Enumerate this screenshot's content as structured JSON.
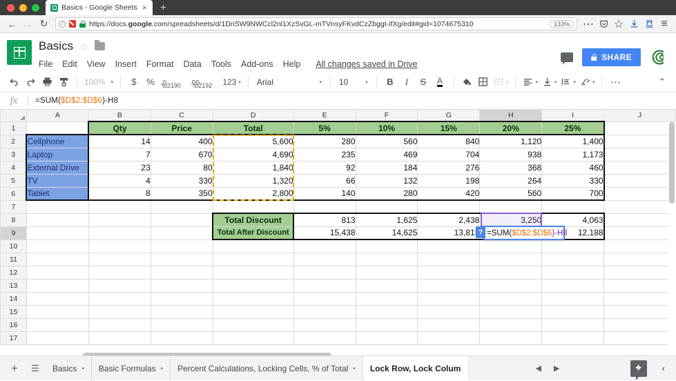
{
  "browser": {
    "tab": {
      "title": "Basics - Google Sheets",
      "favicon": "sheets-favicon",
      "close": "×"
    },
    "new_tab": "+",
    "back": "←",
    "forward": "→",
    "reload": "↻",
    "url": "https://docs.google.com/spreadsheets/d/1DnSW9NWCcl2nl1XzSvGL-mTVnsyFKvdCzZbggt-ifXg/edit#gid=1074675310",
    "url_prefix": "https://docs.",
    "url_bold": "google",
    "url_suffix": ".com/spreadsheets/d/1DnSW9NWCcl2nl1XzSvGL-mTVnsyFKvdCzZbggt-ifXg/edit#gid=1074675310",
    "zoom_level": "133%",
    "overflow": "⋯",
    "shield_icon": "tracking-protection-icon",
    "pocket_icon": "pocket-icon",
    "bookmark_icon": "☆",
    "download_icon": "⬇",
    "library_icon": "library-icon",
    "menu_icon": "≡"
  },
  "app": {
    "doc_title": "Basics",
    "star": "☆",
    "menus": [
      "File",
      "Edit",
      "View",
      "Insert",
      "Format",
      "Data",
      "Tools",
      "Add-ons",
      "Help"
    ],
    "save_status": "All changes saved in Drive",
    "share_label": "SHARE",
    "comment_icon": "comment-icon",
    "avatar": "user-avatar"
  },
  "toolbar": {
    "undo": "↶",
    "redo": "↷",
    "print": "print-icon",
    "paint_format": "paint-format-icon",
    "zoom": "100%",
    "currency": "$",
    "percent": "%",
    "decrease_decimal": ".0",
    "increase_decimal": ".00",
    "more_formats": "123",
    "font": "Arial",
    "font_size": "10",
    "bold": "B",
    "italic": "I",
    "strikethrough": "S",
    "text_color": "A",
    "fill_color": "fill-color-icon",
    "borders": "borders-icon",
    "merge_cells": "merge-cells-icon",
    "horizontal_align": "align-icon",
    "vertical_align": "vertical-align-icon",
    "text_wrap": "text-wrap-icon",
    "text_rotation": "text-rotation-icon",
    "more": "⋯",
    "collapse": "⌃"
  },
  "formula_bar": {
    "fx": "fx",
    "value_plain": "=SUM($D$2:$D$6)-H8",
    "part1": "=SUM(",
    "part2": "$D$2:$D$6",
    "part3": ")-H8"
  },
  "grid": {
    "columns": [
      "A",
      "B",
      "C",
      "D",
      "E",
      "F",
      "G",
      "H",
      "I",
      "J"
    ],
    "selected_column": "H",
    "selected_row": "9",
    "rows": [
      "1",
      "2",
      "3",
      "4",
      "5",
      "6",
      "7",
      "8",
      "9",
      "10",
      "11",
      "12",
      "13",
      "14",
      "15",
      "16",
      "17"
    ],
    "data": [
      {
        "row": "1",
        "cells": [
          "",
          "Qty",
          "Price",
          "Total",
          "5%",
          "10%",
          "15%",
          "20%",
          "25%",
          ""
        ]
      },
      {
        "row": "2",
        "cells": [
          "Cellphone",
          "14",
          "400",
          "5,600",
          "280",
          "560",
          "840",
          "1,120",
          "1,400",
          ""
        ]
      },
      {
        "row": "3",
        "cells": [
          "Laptop",
          "7",
          "670",
          "4,690",
          "235",
          "469",
          "704",
          "938",
          "1,173",
          ""
        ]
      },
      {
        "row": "4",
        "cells": [
          "External Drive",
          "23",
          "80",
          "1,840",
          "92",
          "184",
          "276",
          "368",
          "460",
          ""
        ]
      },
      {
        "row": "5",
        "cells": [
          "TV",
          "4",
          "330",
          "1,320",
          "66",
          "132",
          "198",
          "264",
          "330",
          ""
        ]
      },
      {
        "row": "6",
        "cells": [
          "Tablet",
          "8",
          "350",
          "2,800",
          "140",
          "280",
          "420",
          "560",
          "700",
          ""
        ]
      },
      {
        "row": "7",
        "cells": [
          "",
          "",
          "",
          "",
          "",
          "",
          "",
          "",
          "",
          ""
        ]
      },
      {
        "row": "8",
        "cells": [
          "",
          "",
          "",
          "Total Discount",
          "813",
          "1,625",
          "2,438",
          "3,250",
          "4,063",
          ""
        ]
      },
      {
        "row": "9",
        "cells": [
          "",
          "",
          "",
          "Total After Discount",
          "15,438",
          "14,625",
          "13,813",
          "",
          "12,188",
          ""
        ]
      },
      {
        "row": "10",
        "cells": [
          "",
          "",
          "",
          "",
          "",
          "",
          "",
          "",
          "",
          ""
        ]
      },
      {
        "row": "11",
        "cells": [
          "",
          "",
          "",
          "",
          "",
          "",
          "",
          "",
          "",
          ""
        ]
      },
      {
        "row": "12",
        "cells": [
          "",
          "",
          "",
          "",
          "",
          "",
          "",
          "",
          "",
          ""
        ]
      },
      {
        "row": "13",
        "cells": [
          "",
          "",
          "",
          "",
          "",
          "",
          "",
          "",
          "",
          ""
        ]
      },
      {
        "row": "14",
        "cells": [
          "",
          "",
          "",
          "",
          "",
          "",
          "",
          "",
          "",
          ""
        ]
      },
      {
        "row": "15",
        "cells": [
          "",
          "",
          "",
          "",
          "",
          "",
          "",
          "",
          "",
          ""
        ]
      },
      {
        "row": "16",
        "cells": [
          "",
          "",
          "",
          "",
          "",
          "",
          "",
          "",
          "",
          ""
        ]
      },
      {
        "row": "17",
        "cells": [
          "",
          "",
          "",
          "",
          "",
          "",
          "",
          "",
          "",
          ""
        ]
      }
    ],
    "editing_cell": "H9",
    "editor": {
      "part1": "=SUM(",
      "part2": "$D$2:$D$6",
      "part3": ")-H8",
      "help_badge": "?"
    },
    "copied_range": "D2:D6",
    "highlighted_ref": "H8"
  },
  "sheet_bar": {
    "add_sheet": "+",
    "all_sheets": "☰",
    "tabs": [
      {
        "label": "Basics",
        "active": false
      },
      {
        "label": "Basic Formulas",
        "active": false
      },
      {
        "label": "Percent Calculations, Locking Cells, % of Total",
        "active": false
      },
      {
        "label": "Lock Row, Lock Colum",
        "active": true
      }
    ],
    "prev": "◀",
    "next": "▶",
    "explore": "✦",
    "collapse": "‹"
  }
}
